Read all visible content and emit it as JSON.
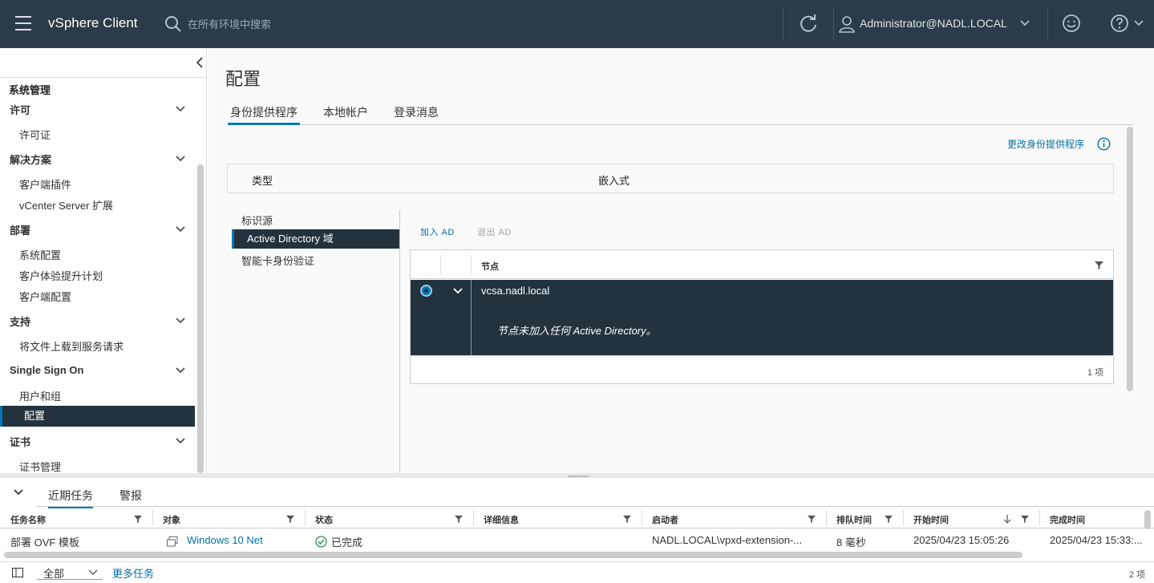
{
  "header": {
    "app_title": "vSphere Client",
    "search_placeholder": "在所有环境中搜索",
    "user": "Administrator@NADL.LOCAL"
  },
  "sidebar": {
    "title": "系统管理",
    "groups": [
      {
        "label": "许可",
        "items": [
          "许可证"
        ]
      },
      {
        "label": "解决方案",
        "items": [
          "客户端插件",
          "vCenter Server 扩展"
        ]
      },
      {
        "label": "部署",
        "items": [
          "系统配置",
          "客户体验提升计划",
          "客户端配置"
        ]
      },
      {
        "label": "支持",
        "items": [
          "将文件上载到服务请求"
        ]
      },
      {
        "label": "Single Sign On",
        "items": [
          "用户和组",
          "配置"
        ]
      },
      {
        "label": "证书",
        "items": [
          "证书管理"
        ]
      }
    ],
    "active_item": "配置"
  },
  "main": {
    "page_title": "配置",
    "tabs": [
      "身份提供程序",
      "本地帐户",
      "登录消息"
    ],
    "active_tab": "身份提供程序",
    "change_link": "更改身份提供程序",
    "type_label": "类型",
    "type_value": "嵌入式",
    "vnav": [
      "标识源",
      "Active Directory 域",
      "智能卡身份验证"
    ],
    "vnav_active": "Active Directory 域",
    "join_ad": "加入 AD",
    "leave_ad": "退出 AD",
    "grid": {
      "col_node": "节点",
      "row_node": "vcsa.nadl.local",
      "row_detail": "节点未加入任何 Active Directory。",
      "count": "1 项"
    }
  },
  "tasks": {
    "tabs": [
      "近期任务",
      "警报"
    ],
    "active_tab": "近期任务",
    "columns": [
      "任务名称",
      "对象",
      "状态",
      "详细信息",
      "启动者",
      "排队时间",
      "开始时间",
      "完成时间"
    ],
    "rows": [
      {
        "name": "部署 OVF 模板",
        "object": "Windows 10 Net",
        "status": "已完成",
        "details": "",
        "initiator": "NADL.LOCAL\\vpxd-extension-...",
        "queued": "8 毫秒",
        "start": "2025/04/23 15:05:26",
        "finish": "2025/04/23 15:33:..."
      }
    ],
    "filter_value": "全部",
    "more_link": "更多任务",
    "count": "2 项"
  },
  "colors": {
    "header_bg": "#2d3b48",
    "selected_bg": "#24323d",
    "accent": "#0079b8",
    "link": "#0072a3",
    "success": "#2e8b57"
  }
}
